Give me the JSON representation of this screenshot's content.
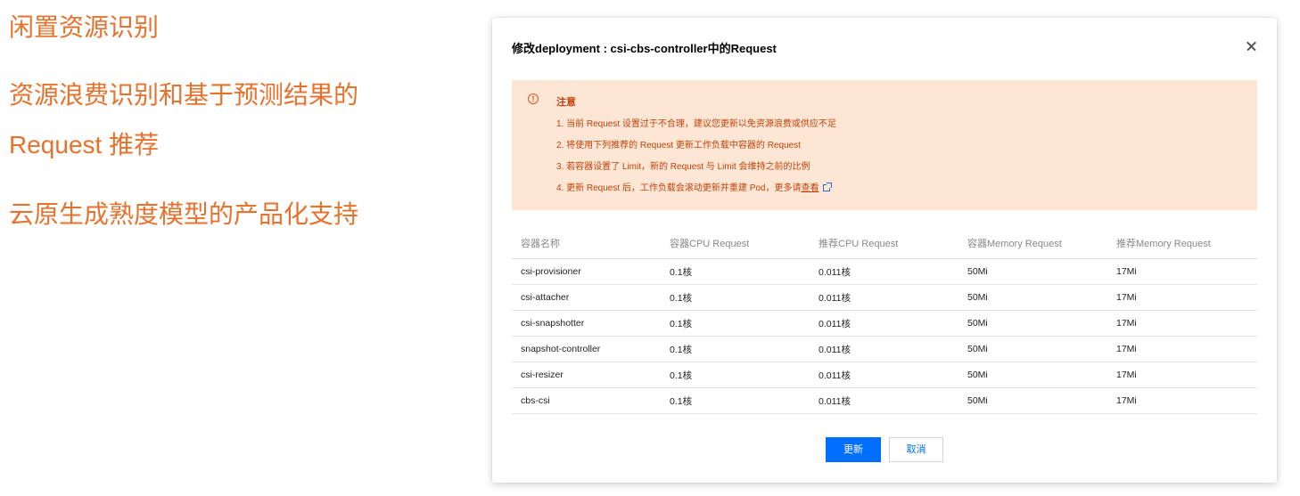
{
  "features": [
    "闲置资源识别",
    "资源浪费识别和基于预测结果的",
    "Request 推荐",
    "云原生成熟度模型的产品化支持"
  ],
  "dialog": {
    "title": "修改deployment : csi-cbs-controller中的Request",
    "notice": {
      "title": "注意",
      "items": [
        "1. 当前 Request 设置过于不合理，建议您更新以免资源浪费或供应不足",
        "2. 将使用下列推荐的 Request 更新工作负载中容器的 Request",
        "3. 若容器设置了 Limit，新的 Request 与 Limit 会维持之前的比例",
        "4. 更新 Request 后，工作负载会滚动更新并重建 Pod，更多请"
      ],
      "link_text": "查看"
    },
    "table": {
      "headers": [
        "容器名称",
        "容器CPU Request",
        "推荐CPU Request",
        "容器Memory Request",
        "推荐Memory Request"
      ],
      "rows": [
        [
          "csi-provisioner",
          "0.1核",
          "0.011核",
          "50Mi",
          "17Mi"
        ],
        [
          "csi-attacher",
          "0.1核",
          "0.011核",
          "50Mi",
          "17Mi"
        ],
        [
          "csi-snapshotter",
          "0.1核",
          "0.011核",
          "50Mi",
          "17Mi"
        ],
        [
          "snapshot-controller",
          "0.1核",
          "0.011核",
          "50Mi",
          "17Mi"
        ],
        [
          "csi-resizer",
          "0.1核",
          "0.011核",
          "50Mi",
          "17Mi"
        ],
        [
          "cbs-csi",
          "0.1核",
          "0.011核",
          "50Mi",
          "17Mi"
        ]
      ]
    },
    "buttons": {
      "update": "更新",
      "cancel": "取消"
    }
  },
  "colors": {
    "feature_text": "#e8712c",
    "notice_bg": "#fde6d3",
    "notice_text": "#c2410c",
    "primary": "#006eff"
  },
  "icons": {
    "notice": "warning-circle-icon",
    "close": "close-icon",
    "external_link": "external-link-icon"
  }
}
